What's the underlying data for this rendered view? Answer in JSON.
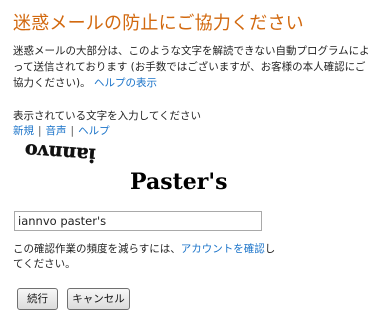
{
  "title": "迷惑メールの防止にご協力ください",
  "intro": {
    "text": "迷惑メールの大部分は、このような文字を解読できない自動プログラムによって送信されております (お手数ではございますが、お客様の本人確認にご協力ください)。",
    "help_link": "ヘルプの表示"
  },
  "prompt": "表示されている文字を入力してください",
  "links": {
    "new": "新規",
    "audio": "音声",
    "help": "ヘルプ"
  },
  "captcha": {
    "word1": "iannvo",
    "word2": "Paster's"
  },
  "answer": {
    "value": "iannvo paster's"
  },
  "frequency": {
    "text_before": "この確認作業の頻度を減らすには、",
    "link": "アカウントを確認",
    "text_after": "してください。"
  },
  "buttons": {
    "continue": "続行",
    "cancel": "キャンセル"
  },
  "colors": {
    "title": "#d2690f",
    "link": "#1a73c9"
  }
}
